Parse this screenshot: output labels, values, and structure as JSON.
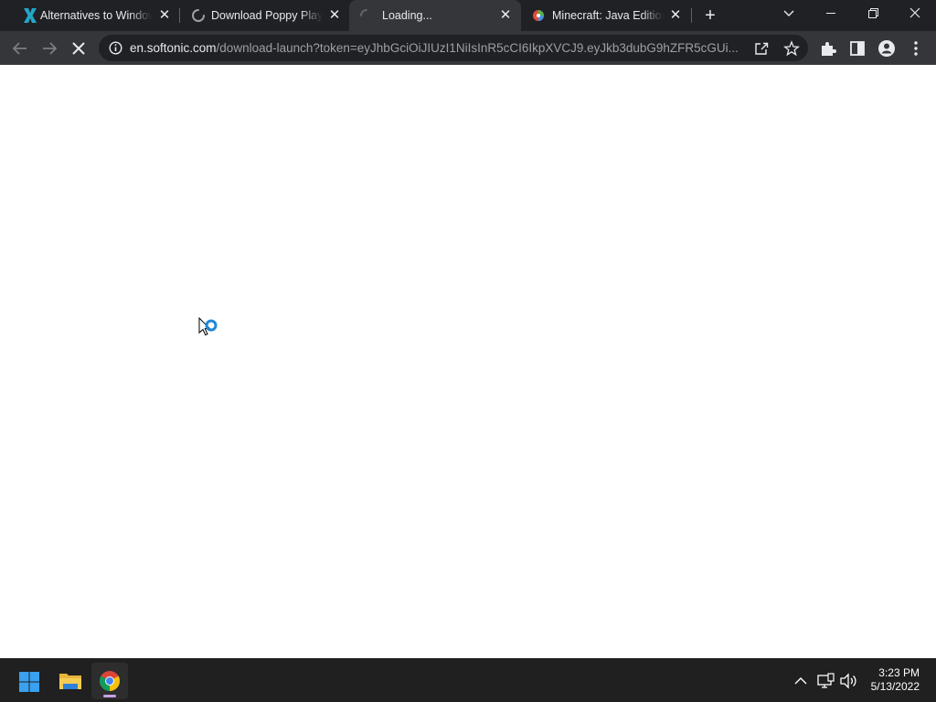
{
  "browser": {
    "tabs": [
      {
        "title": "Alternatives to Windows",
        "favicon": "x-logo-icon",
        "state": "inactive"
      },
      {
        "title": "Download Poppy Playtime",
        "favicon": "loading-spinner-icon",
        "state": "inactive"
      },
      {
        "title": "Loading...",
        "favicon": "loading-spinner-icon",
        "state": "active"
      },
      {
        "title": "Minecraft: Java Edition",
        "favicon": "minecraft-icon",
        "state": "inactive"
      }
    ],
    "new_tab_label": "+",
    "window_controls": [
      "chevron-down-icon",
      "minimize-icon",
      "restore-icon",
      "close-icon"
    ],
    "toolbar": {
      "back": "back-arrow-icon",
      "forward": "forward-arrow-icon",
      "stop": "stop-loading-icon",
      "site_info": "info-icon",
      "share": "share-icon",
      "bookmark": "star-icon",
      "extensions": "puzzle-icon",
      "side_panel": "side-panel-icon",
      "profile": "profile-icon",
      "menu": "kebab-menu-icon"
    },
    "address": {
      "host": "en.softonic.com",
      "path": "/download-launch?token=eyJhbGciOiJIUzI1NiIsInR5cCI6IkpXVCJ9.eyJkb3dubG9hZFR5cGUi..."
    }
  },
  "taskbar": {
    "apps": [
      "windows-start-icon",
      "file-explorer-icon",
      "chrome-icon"
    ],
    "tray": [
      "chevron-up-icon",
      "network-icon",
      "volume-icon"
    ],
    "time": "3:23 PM",
    "date": "5/13/2022"
  },
  "colors": {
    "tabstrip": "#202124",
    "toolbar": "#35363a",
    "omnibox": "#202124",
    "taskbar": "#202020",
    "page": "#ffffff"
  }
}
